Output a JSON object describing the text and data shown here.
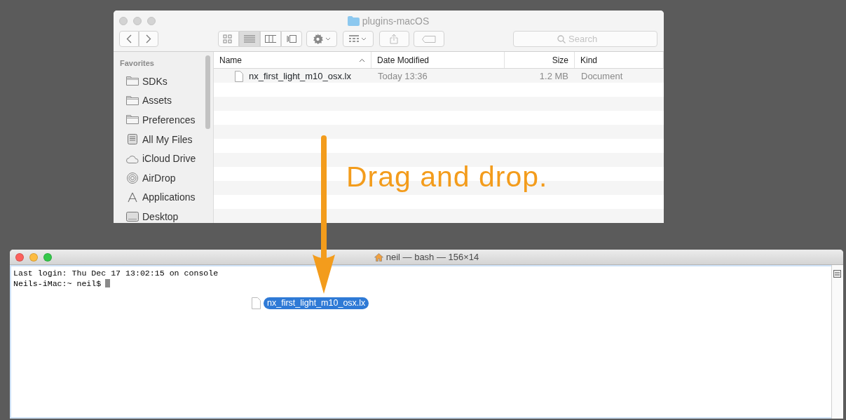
{
  "finder": {
    "title": "plugins-macOS",
    "active": false,
    "view_modes": [
      {
        "kind": "icons",
        "selected": false
      },
      {
        "kind": "list",
        "selected": true
      },
      {
        "kind": "columns",
        "selected": false
      },
      {
        "kind": "coverflow",
        "selected": false
      }
    ],
    "search": {
      "placeholder": "Search"
    },
    "sidebar": {
      "heading": "Favorites",
      "items": [
        {
          "label": "SDKs",
          "kind": "folder"
        },
        {
          "label": "Assets",
          "kind": "folder"
        },
        {
          "label": "Preferences",
          "kind": "folder"
        },
        {
          "label": "All My Files",
          "kind": "files"
        },
        {
          "label": "iCloud Drive",
          "kind": "cloud"
        },
        {
          "label": "AirDrop",
          "kind": "airdrop"
        },
        {
          "label": "Applications",
          "kind": "apps"
        },
        {
          "label": "Desktop",
          "kind": "desktop"
        }
      ]
    },
    "columns": [
      {
        "label": "Name",
        "sorted": true
      },
      {
        "label": "Date Modified",
        "sorted": false
      },
      {
        "label": "Size",
        "sorted": false
      },
      {
        "label": "Kind",
        "sorted": false
      }
    ],
    "rows": [
      {
        "name": "nx_first_light_m10_osx.lx",
        "date": "Today 13:36",
        "size": "1.2 MB",
        "kind": "Document"
      }
    ]
  },
  "terminal": {
    "title": "neil — bash — 156×14",
    "active": true,
    "lines": [
      {
        "text": "Last login: Thu Dec 17 13:02:15 on console",
        "cursor": false
      },
      {
        "text": "Neils-iMac:~ neil$",
        "cursor": true
      }
    ]
  },
  "annotation": {
    "text": "Drag and drop."
  },
  "drag": {
    "label": "nx_first_light_m10_osx.lx"
  }
}
